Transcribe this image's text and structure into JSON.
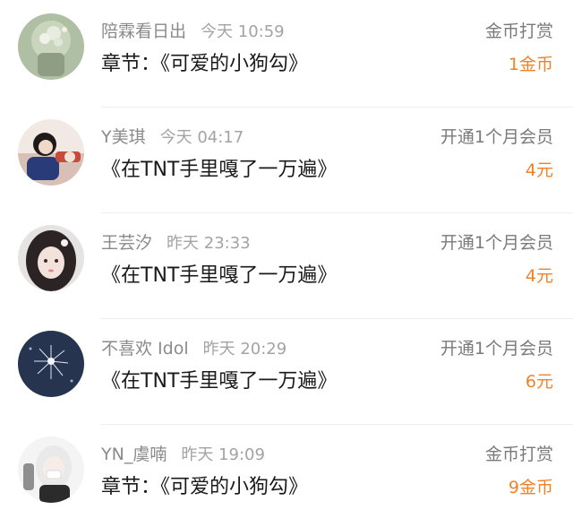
{
  "rows": [
    {
      "user": "陪霖看日出",
      "time": "今天 10:59",
      "content": "章节：《可爱的小狗勾》",
      "type": "金币打赏",
      "amount": "1金币"
    },
    {
      "user": "Y美琪",
      "time": "今天 04:17",
      "content": "《在TNT手里嘎了一万遍》",
      "type": "开通1个月会员",
      "amount": "4元"
    },
    {
      "user": "王芸汐",
      "time": "昨天 23:33",
      "content": "《在TNT手里嘎了一万遍》",
      "type": "开通1个月会员",
      "amount": "4元"
    },
    {
      "user": "不喜欢 Idol",
      "time": "昨天 20:29",
      "content": "《在TNT手里嘎了一万遍》",
      "type": "开通1个月会员",
      "amount": "6元"
    },
    {
      "user": "YN_虞喃",
      "time": "昨天 19:09",
      "content": "章节：《可爱的小狗勾》",
      "type": "金币打赏",
      "amount": "9金币"
    }
  ],
  "colors": {
    "amount": "#f0822a",
    "name": "#8a8a8a",
    "content": "#1a1a1a"
  }
}
